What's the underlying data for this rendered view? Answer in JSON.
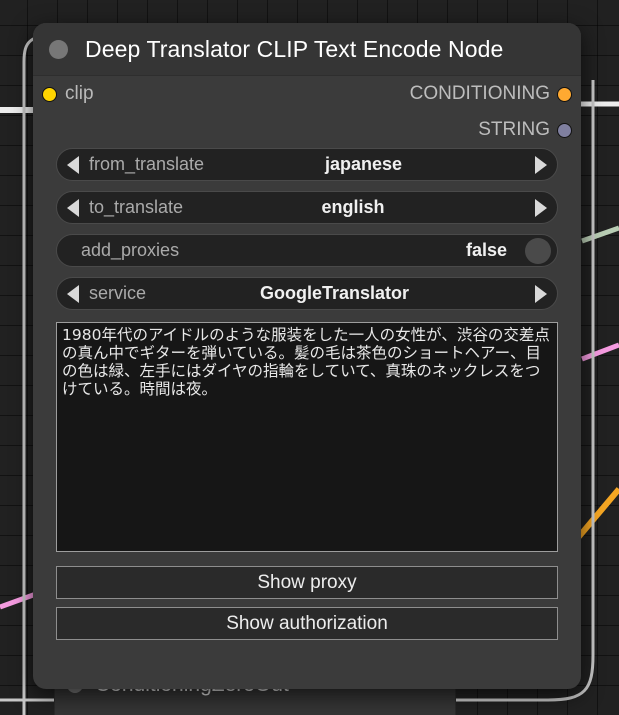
{
  "node": {
    "title": "Deep Translator CLIP Text Encode Node",
    "collapse_icon": "collapse-dot-icon",
    "inputs": [
      {
        "name": "clip",
        "label": "clip",
        "color": "#FFD500",
        "icon": "input-slot-dot-icon"
      }
    ],
    "outputs": [
      {
        "name": "CONDITIONING",
        "label": "CONDITIONING",
        "color": "#FFA931",
        "icon": "output-slot-dot-icon"
      },
      {
        "name": "STRING",
        "label": "STRING",
        "color": "#7F7F9F",
        "icon": "output-slot-dot-icon"
      }
    ],
    "widgets": [
      {
        "type": "combo",
        "name": "from_translate",
        "label": "from_translate",
        "value": "japanese",
        "left_icon": "chevron-left-icon",
        "right_icon": "chevron-right-icon"
      },
      {
        "type": "combo",
        "name": "to_translate",
        "label": "to_translate",
        "value": "english",
        "left_icon": "chevron-left-icon",
        "right_icon": "chevron-right-icon"
      },
      {
        "type": "toggle",
        "name": "add_proxies",
        "label": "add_proxies",
        "value": "false",
        "knob_icon": "toggle-knob-icon"
      },
      {
        "type": "combo",
        "name": "service",
        "label": "service",
        "value": "GoogleTranslator",
        "left_icon": "chevron-left-icon",
        "right_icon": "chevron-right-icon"
      }
    ],
    "text_widget": {
      "name": "prompt",
      "value": "1980年代のアイドルのような服装をした一人の女性が、渋谷の交差点の真ん中でギターを弾いている。髪の毛は茶色のショートヘアー、目の色は緑、左手にはダイヤの指輪をしていて、真珠のネックレスをつけている。時間は夜。"
    },
    "buttons": [
      {
        "name": "show-proxy",
        "label": "Show proxy"
      },
      {
        "name": "show-authorization",
        "label": "Show authorization"
      }
    ]
  },
  "background_node": {
    "title": "ConditioningZeroOut",
    "collapse_icon": "collapse-dot-icon"
  },
  "wires": [
    {
      "name": "clip-input-wire",
      "color": "#E8E8E8"
    },
    {
      "name": "conditioning-output-wire",
      "color": "#E8E8E8"
    },
    {
      "name": "string-passthrough-wire",
      "color": "#E8E8E8"
    },
    {
      "name": "green-link-wire",
      "color": "#B9CDB4"
    },
    {
      "name": "pink-link-wire-right",
      "color": "#F59BE0"
    },
    {
      "name": "pink-link-wire-left",
      "color": "#F59BE0"
    },
    {
      "name": "orange-link-wire",
      "color": "#F5A623"
    }
  ],
  "canvas": {
    "background_color": "#212121",
    "grid_color": "#151515",
    "node_body_color": "#3b3b3b",
    "node_title_color": "#353535"
  }
}
